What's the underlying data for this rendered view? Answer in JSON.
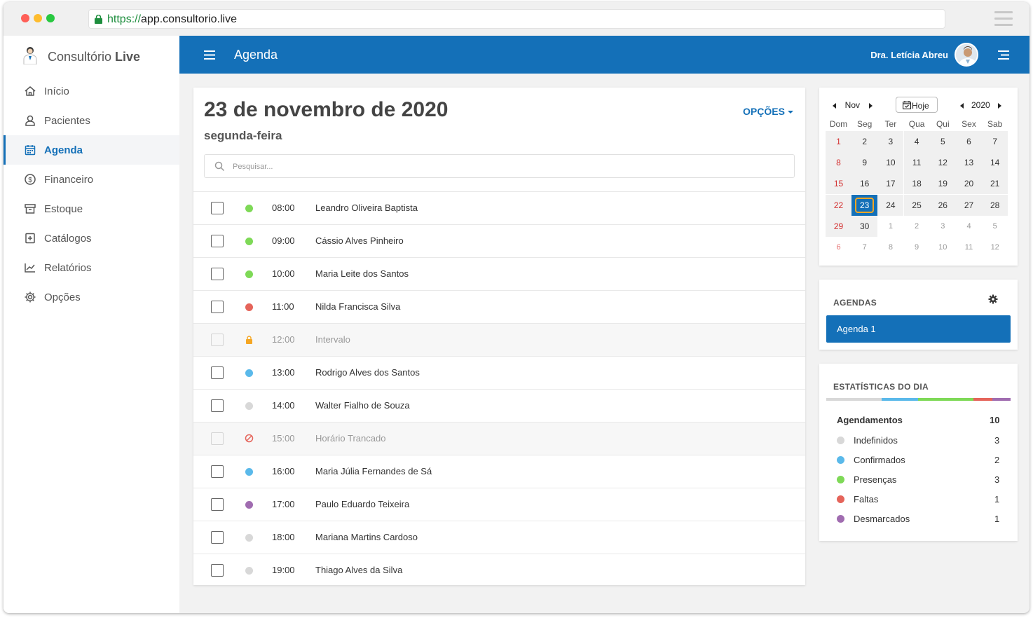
{
  "browser": {
    "url_protocol": "https://",
    "url_host": "app.consultorio.live"
  },
  "brand": {
    "name_regular": "Consultório ",
    "name_bold": "Live"
  },
  "sidebar": {
    "items": [
      {
        "label": "Início",
        "icon": "home-icon"
      },
      {
        "label": "Pacientes",
        "icon": "user-icon"
      },
      {
        "label": "Agenda",
        "icon": "calendar-icon",
        "active": true
      },
      {
        "label": "Financeiro",
        "icon": "dollar-icon"
      },
      {
        "label": "Estoque",
        "icon": "box-icon"
      },
      {
        "label": "Catálogos",
        "icon": "catalog-icon"
      },
      {
        "label": "Relatórios",
        "icon": "chart-icon"
      },
      {
        "label": "Opções",
        "icon": "gear-icon"
      }
    ]
  },
  "header": {
    "title": "Agenda",
    "user_name": "Dra. Letícia Abreu"
  },
  "main": {
    "date_title": "23 de novembro de 2020",
    "weekday": "segunda-feira",
    "options_label": "OPÇÕES",
    "search_placeholder": "Pesquisar...",
    "appointments": [
      {
        "time": "08:00",
        "name": "Leandro Oliveira Baptista",
        "status": "presenca",
        "color": "#7ed957"
      },
      {
        "time": "09:00",
        "name": "Cássio Alves Pinheiro",
        "status": "presenca",
        "color": "#7ed957"
      },
      {
        "time": "10:00",
        "name": "Maria Leite dos Santos",
        "status": "presenca",
        "color": "#7ed957"
      },
      {
        "time": "11:00",
        "name": "Nilda Francisca Silva",
        "status": "falta",
        "color": "#e5645a"
      },
      {
        "time": "12:00",
        "name": "Intervalo",
        "status": "intervalo",
        "color": "#f5a623",
        "icon": "lock-icon"
      },
      {
        "time": "13:00",
        "name": "Rodrigo Alves dos Santos",
        "status": "confirmado",
        "color": "#5ab9ea"
      },
      {
        "time": "14:00",
        "name": "Walter Fialho de Souza",
        "status": "indefinido",
        "color": "#d8d8d8"
      },
      {
        "time": "15:00",
        "name": "Horário Trancado",
        "status": "trancado",
        "color": "#e5645a",
        "icon": "blocked-icon"
      },
      {
        "time": "16:00",
        "name": "Maria Júlia Fernandes de Sá",
        "status": "confirmado",
        "color": "#5ab9ea"
      },
      {
        "time": "17:00",
        "name": "Paulo Eduardo Teixeira",
        "status": "desmarcado",
        "color": "#a06cb0"
      },
      {
        "time": "18:00",
        "name": "Mariana Martins Cardoso",
        "status": "indefinido",
        "color": "#d8d8d8"
      },
      {
        "time": "19:00",
        "name": "Thiago Alves da Silva",
        "status": "indefinido",
        "color": "#d8d8d8"
      }
    ]
  },
  "calendar": {
    "month": "Nov",
    "year": "2020",
    "today_label": "Hoje",
    "weekdays": [
      "Dom",
      "Seg",
      "Ter",
      "Qua",
      "Qui",
      "Sex",
      "Sab"
    ],
    "weeks": [
      [
        "1",
        "2",
        "3",
        "4",
        "5",
        "6",
        "7"
      ],
      [
        "8",
        "9",
        "10",
        "11",
        "12",
        "13",
        "14"
      ],
      [
        "15",
        "16",
        "17",
        "18",
        "19",
        "20",
        "21"
      ],
      [
        "22",
        "23",
        "24",
        "25",
        "26",
        "27",
        "28"
      ],
      [
        "29",
        "30",
        "1",
        "2",
        "3",
        "4",
        "5"
      ],
      [
        "6",
        "7",
        "8",
        "9",
        "10",
        "11",
        "12"
      ]
    ],
    "selected_day": "23"
  },
  "agendas": {
    "title": "AGENDAS",
    "items": [
      "Agenda 1"
    ]
  },
  "stats": {
    "title": "ESTATÍSTICAS DO DIA",
    "total_label": "Agendamentos",
    "total_value": "10",
    "items": [
      {
        "label": "Indefinidos",
        "value": "3",
        "color": "#d8d8d8"
      },
      {
        "label": "Confirmados",
        "value": "2",
        "color": "#5ab9ea"
      },
      {
        "label": "Presenças",
        "value": "3",
        "color": "#7ed957"
      },
      {
        "label": "Faltas",
        "value": "1",
        "color": "#e5645a"
      },
      {
        "label": "Desmarcados",
        "value": "1",
        "color": "#a06cb0"
      }
    ]
  },
  "colors": {
    "accent": "#1470b8"
  }
}
